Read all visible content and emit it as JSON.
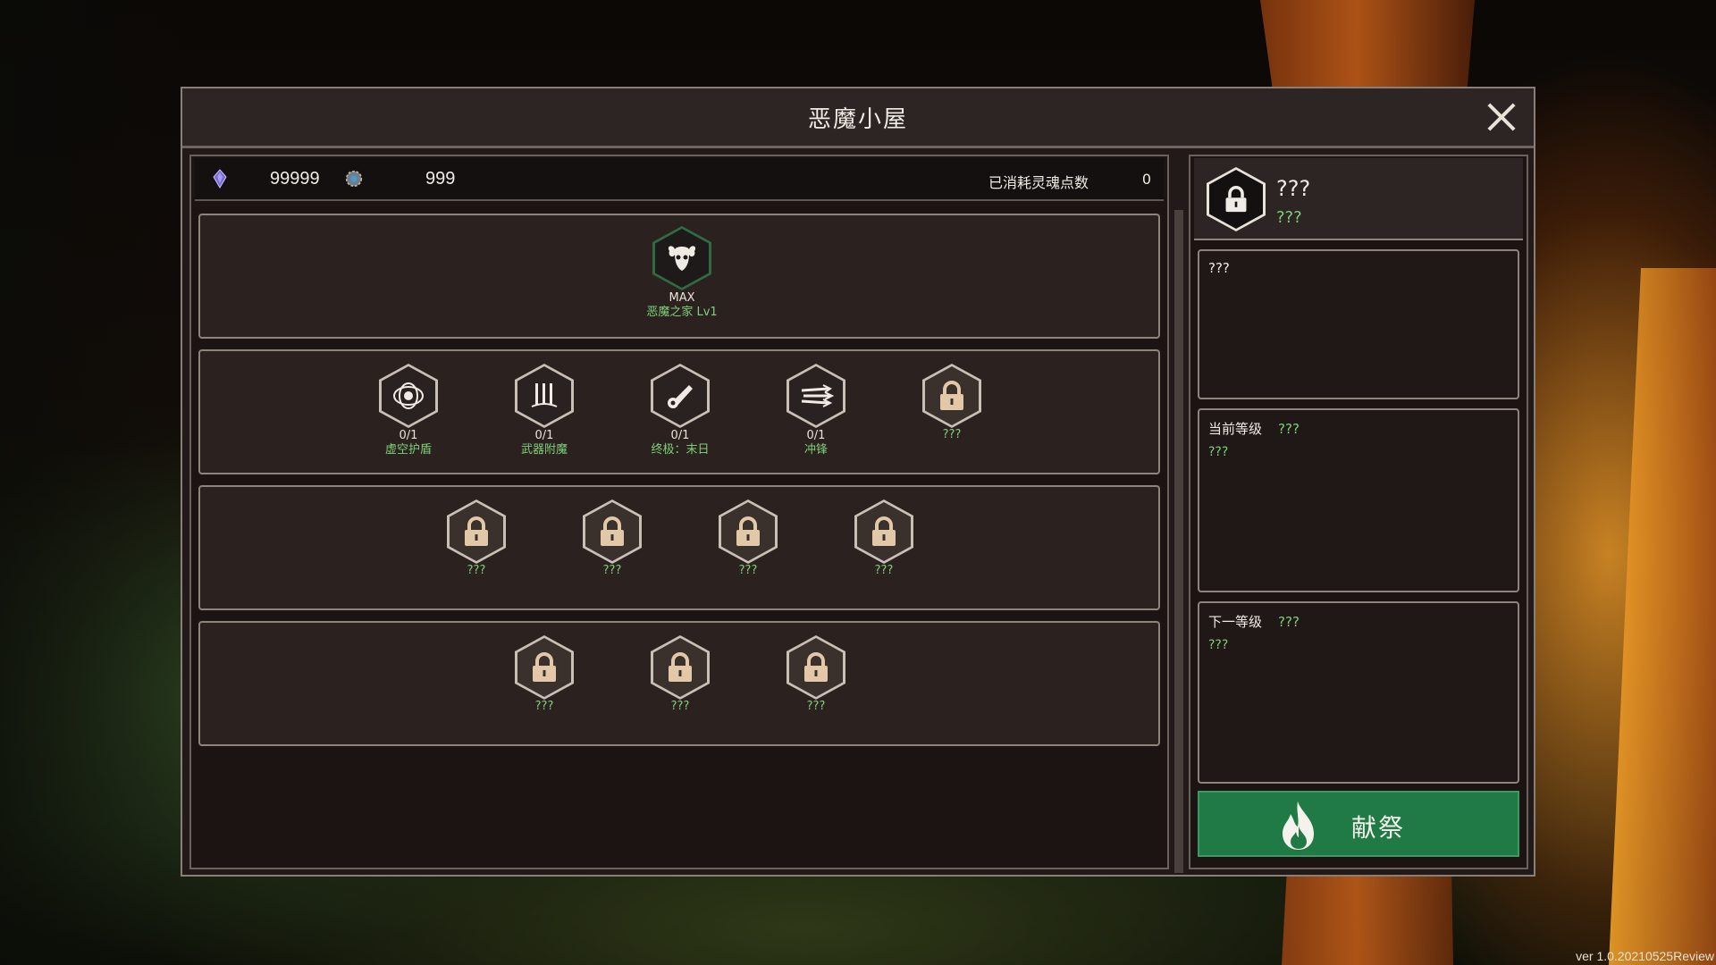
{
  "window": {
    "title": "恶魔小屋"
  },
  "resources": {
    "gem_value": "99999",
    "cog_value": "999",
    "consumed_label": "已消耗灵魂点数",
    "consumed_value": "0"
  },
  "tiers": [
    {
      "nodes": [
        {
          "icon": "ram-skull-icon",
          "count": "MAX",
          "name": "恶魔之家 Lv1",
          "locked": false,
          "style": "green"
        }
      ]
    },
    {
      "nodes": [
        {
          "icon": "void-shield-icon",
          "count": "0/1",
          "name": "虚空护盾",
          "locked": false
        },
        {
          "icon": "weapon-enchant-icon",
          "count": "0/1",
          "name": "武器附魔",
          "locked": false
        },
        {
          "icon": "doomsday-icon",
          "count": "0/1",
          "name": "终极：末日",
          "locked": false
        },
        {
          "icon": "charge-icon",
          "count": "0/1",
          "name": "冲锋",
          "locked": false
        },
        {
          "icon": "lock-icon",
          "count": "",
          "name": "???",
          "locked": true
        }
      ]
    },
    {
      "nodes": [
        {
          "icon": "lock-icon",
          "count": "",
          "name": "???",
          "locked": true
        },
        {
          "icon": "lock-icon",
          "count": "",
          "name": "???",
          "locked": true
        },
        {
          "icon": "lock-icon",
          "count": "",
          "name": "???",
          "locked": true
        },
        {
          "icon": "lock-icon",
          "count": "",
          "name": "???",
          "locked": true
        }
      ]
    },
    {
      "nodes": [
        {
          "icon": "lock-icon",
          "count": "",
          "name": "???",
          "locked": true
        },
        {
          "icon": "lock-icon",
          "count": "",
          "name": "???",
          "locked": true
        },
        {
          "icon": "lock-icon",
          "count": "",
          "name": "???",
          "locked": true
        }
      ]
    }
  ],
  "detail": {
    "title": "???",
    "subtitle": "???",
    "description": "???",
    "current_level_label": "当前等级",
    "current_level_value": "???",
    "current_level_desc": "???",
    "next_level_label": "下一等级",
    "next_level_value": "???",
    "next_level_desc": "???",
    "sacrifice_label": "献祭"
  },
  "version": "ver 1.0.20210525Review",
  "colors": {
    "accent_green": "#1f7a45",
    "text_green": "#7fcf7a",
    "panel": "#211a18"
  }
}
